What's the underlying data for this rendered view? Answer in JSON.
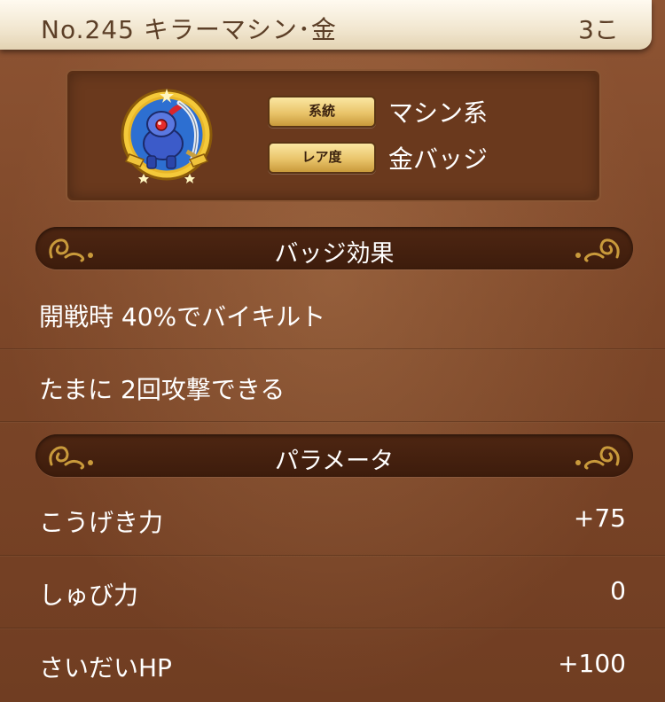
{
  "header": {
    "title": "No.245  キラーマシン･金",
    "count": "3こ"
  },
  "info": {
    "badge_icon": "killer-machine-gold-badge",
    "tags": [
      {
        "label": "系統",
        "value": "マシン系"
      },
      {
        "label": "レア度",
        "value": "金バッジ"
      }
    ]
  },
  "effects": {
    "heading": "バッジ効果",
    "items": [
      {
        "text": "開戦時  40%でバイキルト"
      },
      {
        "text": "たまに   2回攻撃できる"
      }
    ]
  },
  "params": {
    "heading": "パラメータ",
    "items": [
      {
        "label": "こうげき力",
        "value": "+75"
      },
      {
        "label": "しゅび力",
        "value": "0"
      },
      {
        "label": "さいだいHP",
        "value": "+100"
      }
    ]
  },
  "colors": {
    "header_bg": "#f1e6cf",
    "header_text": "#5c3f27",
    "panel_bg": "#6a391d",
    "section_bar": "#3d1c0c",
    "gold_tag": "#e9c46a",
    "ornament": "#c99a3b"
  }
}
